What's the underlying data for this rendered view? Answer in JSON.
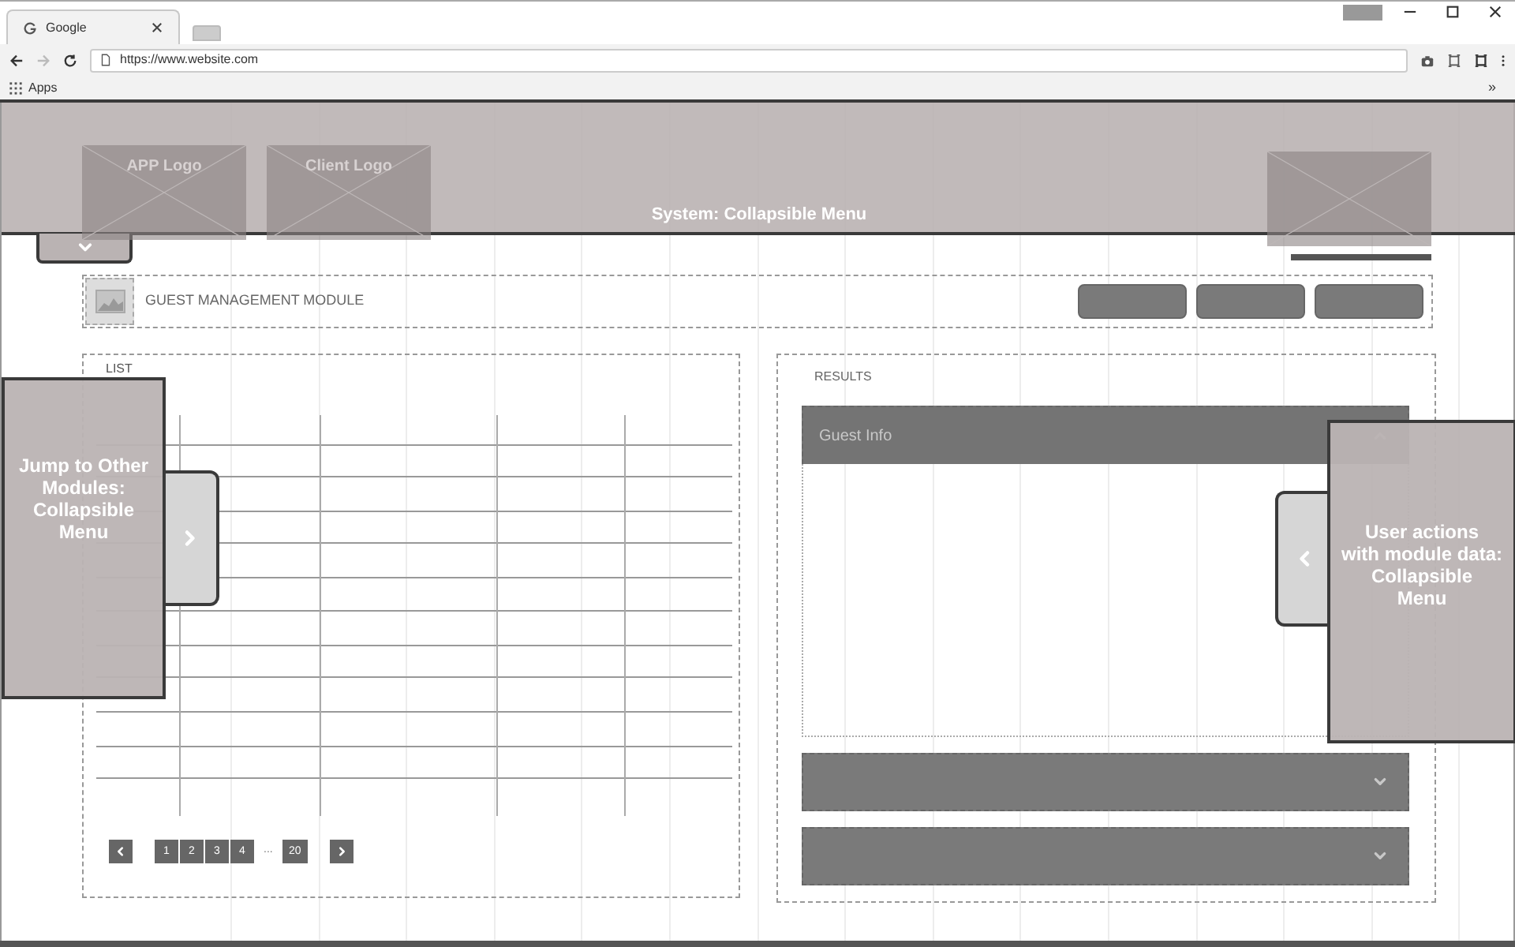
{
  "browser": {
    "tabs": [
      {
        "title": "Google",
        "selected": true
      }
    ],
    "url": "https://www.website.com",
    "bookmarks": [
      {
        "label": "Apps"
      }
    ],
    "overflow": "»"
  },
  "header": {
    "title": "System: Collapsible Menu",
    "logos": [
      "APP Logo",
      "Client Logo"
    ]
  },
  "module": {
    "title": "GUEST MANAGEMENT MODULE"
  },
  "list": {
    "title": "LIST",
    "pages": [
      "1",
      "2",
      "3",
      "4"
    ],
    "ellipsis": "...",
    "last_page": "20"
  },
  "results": {
    "title": "RESULTS",
    "sections": [
      {
        "title": "Guest Info",
        "expanded": true
      },
      {
        "expanded": false
      },
      {
        "expanded": false
      }
    ]
  },
  "side_menus": [
    {
      "kind": "left",
      "lines": [
        "Jump to Other",
        "Modules:",
        "Collapsible",
        "Menu"
      ]
    },
    {
      "kind": "right",
      "lines": [
        "User actions",
        "with module data:",
        "Collapsible",
        "Menu"
      ]
    }
  ]
}
